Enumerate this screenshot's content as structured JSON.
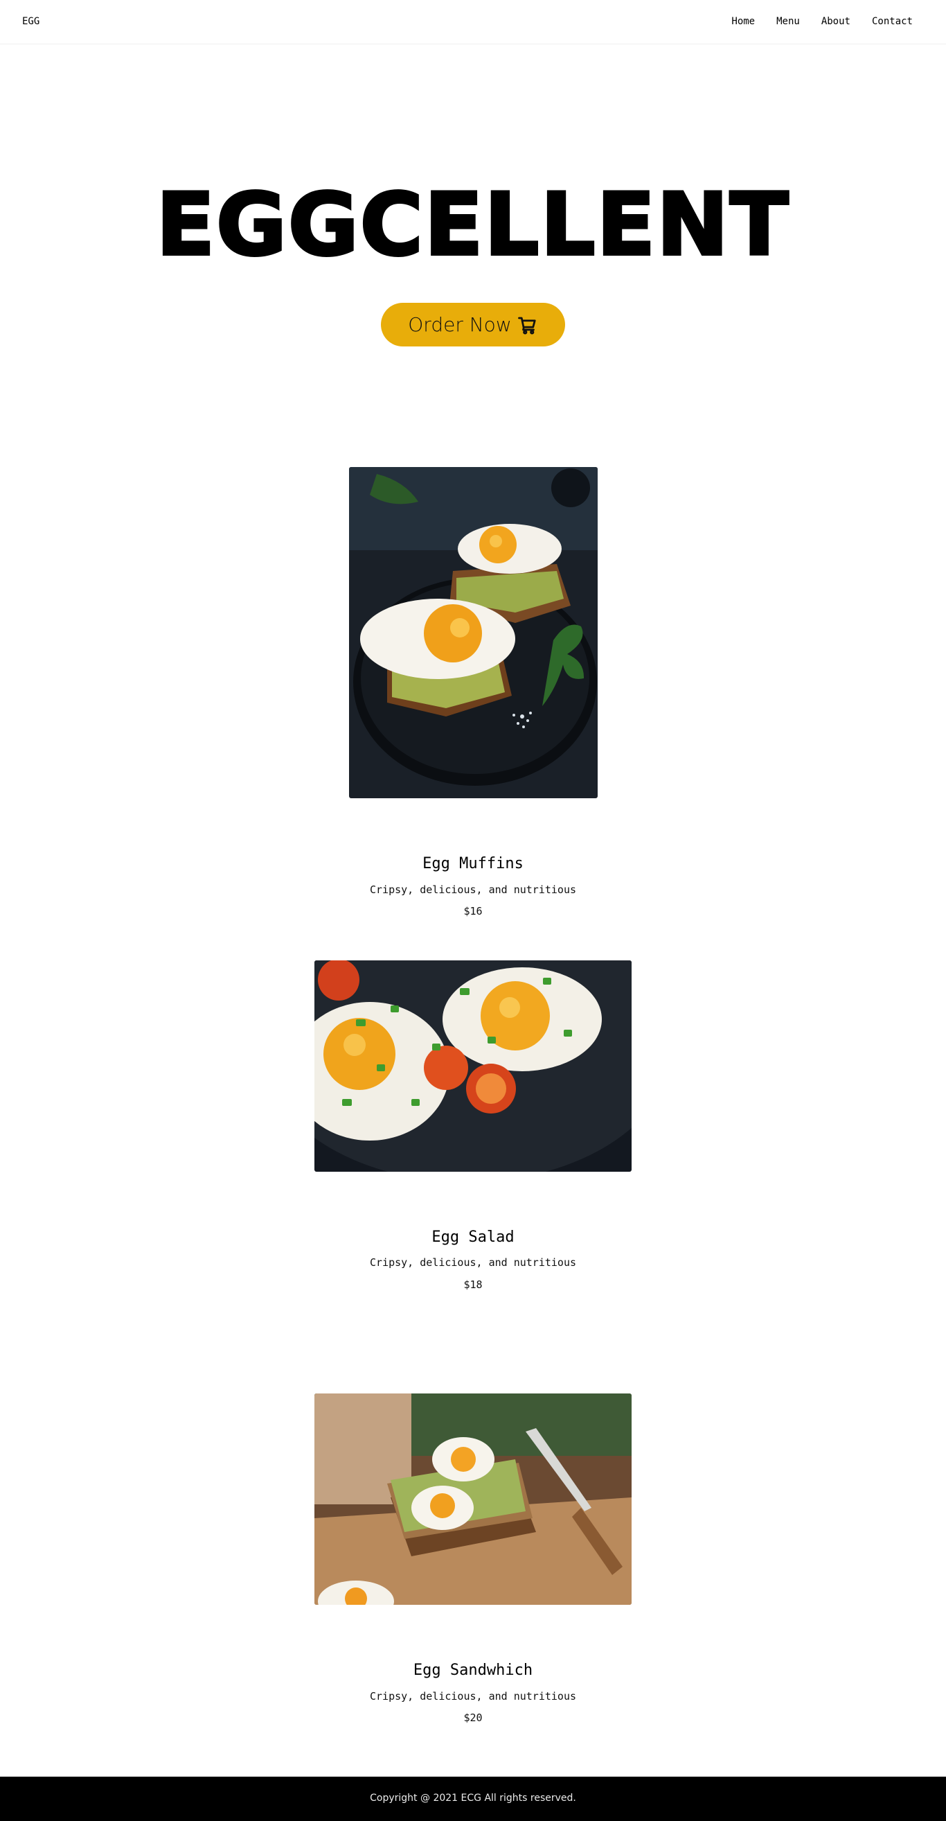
{
  "header": {
    "logo": "EGG",
    "nav": [
      "Home",
      "Menu",
      "About",
      "Contact"
    ]
  },
  "hero": {
    "title": "EGGCELLENT",
    "cta_label": "Order Now",
    "cta_icon": "cart-icon",
    "cta_color": "#e8ad0a"
  },
  "menu": [
    {
      "name": "Egg Muffins",
      "description": "Cripsy, delicious, and nutritious",
      "price": "$16",
      "image": "fried-egg-avocado-toast-photo"
    },
    {
      "name": "Egg Salad",
      "description": "Cripsy, delicious, and nutritious",
      "price": "$18",
      "image": "fried-eggs-tomatoes-photo"
    },
    {
      "name": "Egg Sandwhich",
      "description": "Cripsy, delicious, and nutritious",
      "price": "$20",
      "image": "boiled-egg-avocado-toast-photo"
    }
  ],
  "footer": {
    "copyright": "Copyright @ 2021 ECG All rights reserved."
  }
}
